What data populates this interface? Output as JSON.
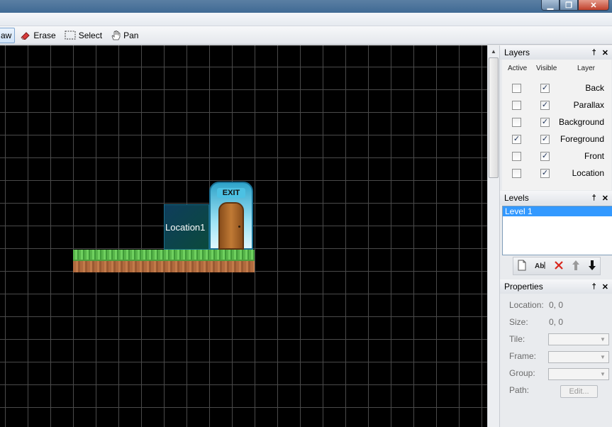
{
  "window": {
    "buttons": [
      "minimize",
      "restore",
      "close"
    ]
  },
  "toolbar": {
    "draw_label": "aw",
    "erase_label": "Erase",
    "select_label": "Select",
    "pan_label": "Pan"
  },
  "canvas": {
    "location_label": "Location1",
    "door_sign": "EXIT"
  },
  "layers": {
    "title": "Layers",
    "col_active": "Active",
    "col_visible": "Visible",
    "col_layer": "Layer",
    "rows": [
      {
        "name": "Back",
        "active": false,
        "visible": true
      },
      {
        "name": "Parallax",
        "active": false,
        "visible": true
      },
      {
        "name": "Background",
        "active": false,
        "visible": true
      },
      {
        "name": "Foreground",
        "active": true,
        "visible": true
      },
      {
        "name": "Front",
        "active": false,
        "visible": true
      },
      {
        "name": "Location",
        "active": false,
        "visible": true
      }
    ]
  },
  "levels": {
    "title": "Levels",
    "items": [
      "Level 1"
    ],
    "selected": "Level 1"
  },
  "properties": {
    "title": "Properties",
    "location_label": "Location:",
    "location_value": "0, 0",
    "size_label": "Size:",
    "size_value": "0, 0",
    "tile_label": "Tile:",
    "frame_label": "Frame:",
    "group_label": "Group:",
    "path_label": "Path:",
    "edit_label": "Edit..."
  },
  "panel_buttons": {
    "pin": "†",
    "close": "✕"
  }
}
